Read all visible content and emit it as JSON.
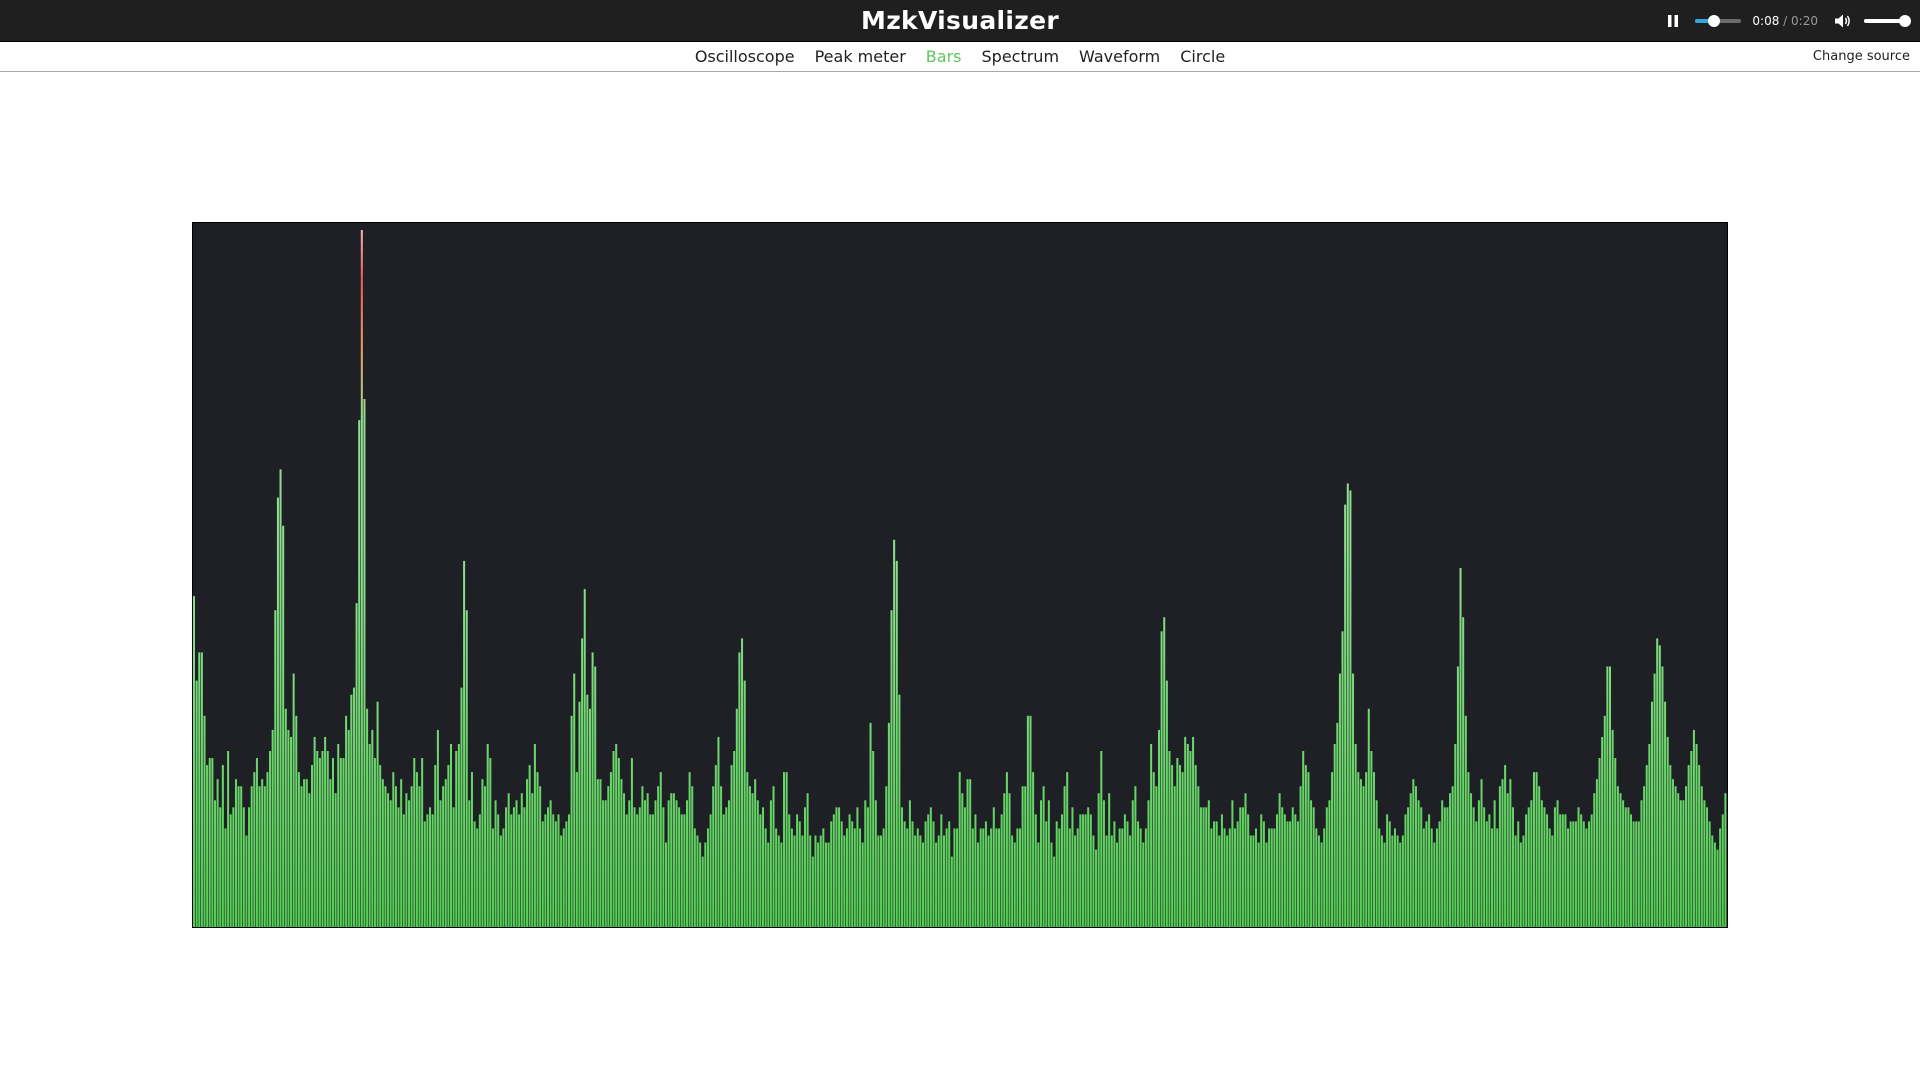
{
  "app": {
    "title": "MzkVisualizer"
  },
  "player": {
    "pause_icon": "pause-icon",
    "current_time": "0:08",
    "separator": "/",
    "duration": "0:20",
    "progress": 0.4,
    "volume_icon": "volume-icon",
    "volume": 0.9,
    "accent_color": "#2ea8e0"
  },
  "nav": {
    "tabs": [
      {
        "label": "Oscilloscope",
        "active": false
      },
      {
        "label": "Peak meter",
        "active": false
      },
      {
        "label": "Bars",
        "active": true
      },
      {
        "label": "Spectrum",
        "active": false
      },
      {
        "label": "Waveform",
        "active": false
      },
      {
        "label": "Circle",
        "active": false
      }
    ],
    "change_source": "Change source",
    "active_color": "#5cc85c",
    "text_color": "#1f1f1f"
  },
  "visualizer": {
    "type": "bars",
    "background": "#1f1f26",
    "bar_color_low": "#52cf52",
    "bar_color_mid": "#8ee08e",
    "bar_color_high": "#f0a060",
    "bar_color_peak": "#f45a5a",
    "levels": [
      0.47,
      0.35,
      0.39,
      0.39,
      0.3,
      0.23,
      0.24,
      0.24,
      0.18,
      0.21,
      0.17,
      0.23,
      0.14,
      0.25,
      0.16,
      0.17,
      0.21,
      0.2,
      0.2,
      0.17,
      0.13,
      0.17,
      0.2,
      0.22,
      0.24,
      0.2,
      0.21,
      0.2,
      0.22,
      0.25,
      0.28,
      0.45,
      0.61,
      0.65,
      0.57,
      0.31,
      0.28,
      0.27,
      0.36,
      0.3,
      0.22,
      0.2,
      0.21,
      0.21,
      0.19,
      0.23,
      0.27,
      0.25,
      0.24,
      0.25,
      0.27,
      0.25,
      0.21,
      0.24,
      0.19,
      0.26,
      0.24,
      0.24,
      0.3,
      0.28,
      0.33,
      0.34,
      0.46,
      0.72,
      0.99,
      0.75,
      0.31,
      0.26,
      0.28,
      0.24,
      0.32,
      0.23,
      0.21,
      0.2,
      0.19,
      0.18,
      0.22,
      0.2,
      0.17,
      0.21,
      0.16,
      0.19,
      0.18,
      0.2,
      0.24,
      0.22,
      0.2,
      0.24,
      0.15,
      0.16,
      0.17,
      0.16,
      0.23,
      0.28,
      0.18,
      0.2,
      0.21,
      0.23,
      0.26,
      0.17,
      0.25,
      0.26,
      0.34,
      0.52,
      0.45,
      0.18,
      0.22,
      0.15,
      0.14,
      0.16,
      0.21,
      0.2,
      0.26,
      0.24,
      0.14,
      0.18,
      0.16,
      0.13,
      0.14,
      0.17,
      0.19,
      0.16,
      0.17,
      0.18,
      0.16,
      0.19,
      0.17,
      0.21,
      0.23,
      0.19,
      0.26,
      0.22,
      0.2,
      0.15,
      0.16,
      0.17,
      0.18,
      0.16,
      0.15,
      0.16,
      0.13,
      0.14,
      0.15,
      0.16,
      0.3,
      0.36,
      0.22,
      0.32,
      0.41,
      0.48,
      0.33,
      0.31,
      0.39,
      0.37,
      0.21,
      0.21,
      0.18,
      0.18,
      0.2,
      0.22,
      0.25,
      0.26,
      0.24,
      0.21,
      0.19,
      0.16,
      0.18,
      0.24,
      0.17,
      0.16,
      0.17,
      0.2,
      0.18,
      0.19,
      0.16,
      0.16,
      0.18,
      0.2,
      0.22,
      0.17,
      0.12,
      0.18,
      0.19,
      0.19,
      0.18,
      0.17,
      0.16,
      0.16,
      0.18,
      0.22,
      0.2,
      0.14,
      0.13,
      0.12,
      0.1,
      0.12,
      0.14,
      0.16,
      0.2,
      0.23,
      0.27,
      0.2,
      0.16,
      0.17,
      0.18,
      0.23,
      0.25,
      0.31,
      0.39,
      0.41,
      0.35,
      0.22,
      0.2,
      0.19,
      0.21,
      0.18,
      0.16,
      0.17,
      0.14,
      0.12,
      0.18,
      0.2,
      0.14,
      0.13,
      0.12,
      0.22,
      0.22,
      0.16,
      0.14,
      0.13,
      0.16,
      0.15,
      0.13,
      0.17,
      0.19,
      0.13,
      0.1,
      0.13,
      0.12,
      0.13,
      0.14,
      0.12,
      0.12,
      0.15,
      0.16,
      0.17,
      0.17,
      0.15,
      0.13,
      0.14,
      0.16,
      0.15,
      0.14,
      0.17,
      0.14,
      0.12,
      0.18,
      0.17,
      0.29,
      0.25,
      0.18,
      0.13,
      0.13,
      0.14,
      0.2,
      0.29,
      0.45,
      0.55,
      0.52,
      0.33,
      0.17,
      0.15,
      0.14,
      0.18,
      0.15,
      0.13,
      0.14,
      0.13,
      0.12,
      0.15,
      0.16,
      0.17,
      0.15,
      0.12,
      0.13,
      0.16,
      0.13,
      0.14,
      0.15,
      0.1,
      0.14,
      0.14,
      0.22,
      0.19,
      0.17,
      0.21,
      0.21,
      0.14,
      0.16,
      0.12,
      0.14,
      0.14,
      0.15,
      0.13,
      0.14,
      0.17,
      0.14,
      0.14,
      0.16,
      0.19,
      0.22,
      0.19,
      0.13,
      0.12,
      0.14,
      0.14,
      0.2,
      0.2,
      0.3,
      0.3,
      0.22,
      0.16,
      0.12,
      0.18,
      0.2,
      0.15,
      0.18,
      0.12,
      0.1,
      0.15,
      0.14,
      0.16,
      0.2,
      0.22,
      0.14,
      0.17,
      0.13,
      0.14,
      0.16,
      0.16,
      0.16,
      0.17,
      0.16,
      0.13,
      0.11,
      0.19,
      0.25,
      0.18,
      0.13,
      0.19,
      0.13,
      0.15,
      0.12,
      0.14,
      0.14,
      0.16,
      0.15,
      0.13,
      0.18,
      0.2,
      0.15,
      0.14,
      0.12,
      0.14,
      0.18,
      0.26,
      0.22,
      0.2,
      0.28,
      0.42,
      0.44,
      0.35,
      0.25,
      0.23,
      0.2,
      0.24,
      0.23,
      0.22,
      0.27,
      0.26,
      0.25,
      0.27,
      0.23,
      0.2,
      0.17,
      0.17,
      0.17,
      0.18,
      0.14,
      0.15,
      0.15,
      0.13,
      0.16,
      0.14,
      0.13,
      0.14,
      0.18,
      0.14,
      0.15,
      0.17,
      0.17,
      0.19,
      0.16,
      0.13,
      0.13,
      0.14,
      0.12,
      0.16,
      0.15,
      0.12,
      0.14,
      0.14,
      0.14,
      0.16,
      0.19,
      0.17,
      0.16,
      0.15,
      0.15,
      0.17,
      0.16,
      0.15,
      0.2,
      0.25,
      0.23,
      0.22,
      0.18,
      0.17,
      0.14,
      0.13,
      0.12,
      0.14,
      0.17,
      0.18,
      0.22,
      0.26,
      0.29,
      0.36,
      0.42,
      0.6,
      0.63,
      0.62,
      0.36,
      0.26,
      0.22,
      0.21,
      0.2,
      0.22,
      0.31,
      0.25,
      0.22,
      0.18,
      0.14,
      0.13,
      0.12,
      0.16,
      0.15,
      0.13,
      0.14,
      0.13,
      0.12,
      0.13,
      0.16,
      0.17,
      0.19,
      0.21,
      0.2,
      0.18,
      0.17,
      0.14,
      0.15,
      0.16,
      0.14,
      0.12,
      0.14,
      0.15,
      0.18,
      0.17,
      0.17,
      0.19,
      0.2,
      0.26,
      0.37,
      0.51,
      0.44,
      0.3,
      0.22,
      0.19,
      0.17,
      0.15,
      0.18,
      0.21,
      0.17,
      0.15,
      0.16,
      0.14,
      0.18,
      0.14,
      0.2,
      0.21,
      0.23,
      0.19,
      0.21,
      0.17,
      0.13,
      0.15,
      0.12,
      0.13,
      0.16,
      0.17,
      0.18,
      0.22,
      0.22,
      0.2,
      0.18,
      0.17,
      0.16,
      0.14,
      0.13,
      0.17,
      0.18,
      0.16,
      0.16,
      0.16,
      0.14,
      0.15,
      0.15,
      0.15,
      0.17,
      0.16,
      0.15,
      0.14,
      0.15,
      0.16,
      0.19,
      0.21,
      0.24,
      0.27,
      0.3,
      0.37,
      0.37,
      0.28,
      0.24,
      0.2,
      0.19,
      0.18,
      0.17,
      0.17,
      0.16,
      0.15,
      0.15,
      0.15,
      0.18,
      0.2,
      0.23,
      0.26,
      0.32,
      0.36,
      0.41,
      0.4,
      0.37,
      0.32,
      0.27,
      0.23,
      0.21,
      0.2,
      0.19,
      0.18,
      0.18,
      0.2,
      0.23,
      0.25,
      0.28,
      0.26,
      0.23,
      0.2,
      0.18,
      0.17,
      0.15,
      0.13,
      0.12,
      0.11,
      0.14,
      0.16,
      0.19
    ]
  }
}
